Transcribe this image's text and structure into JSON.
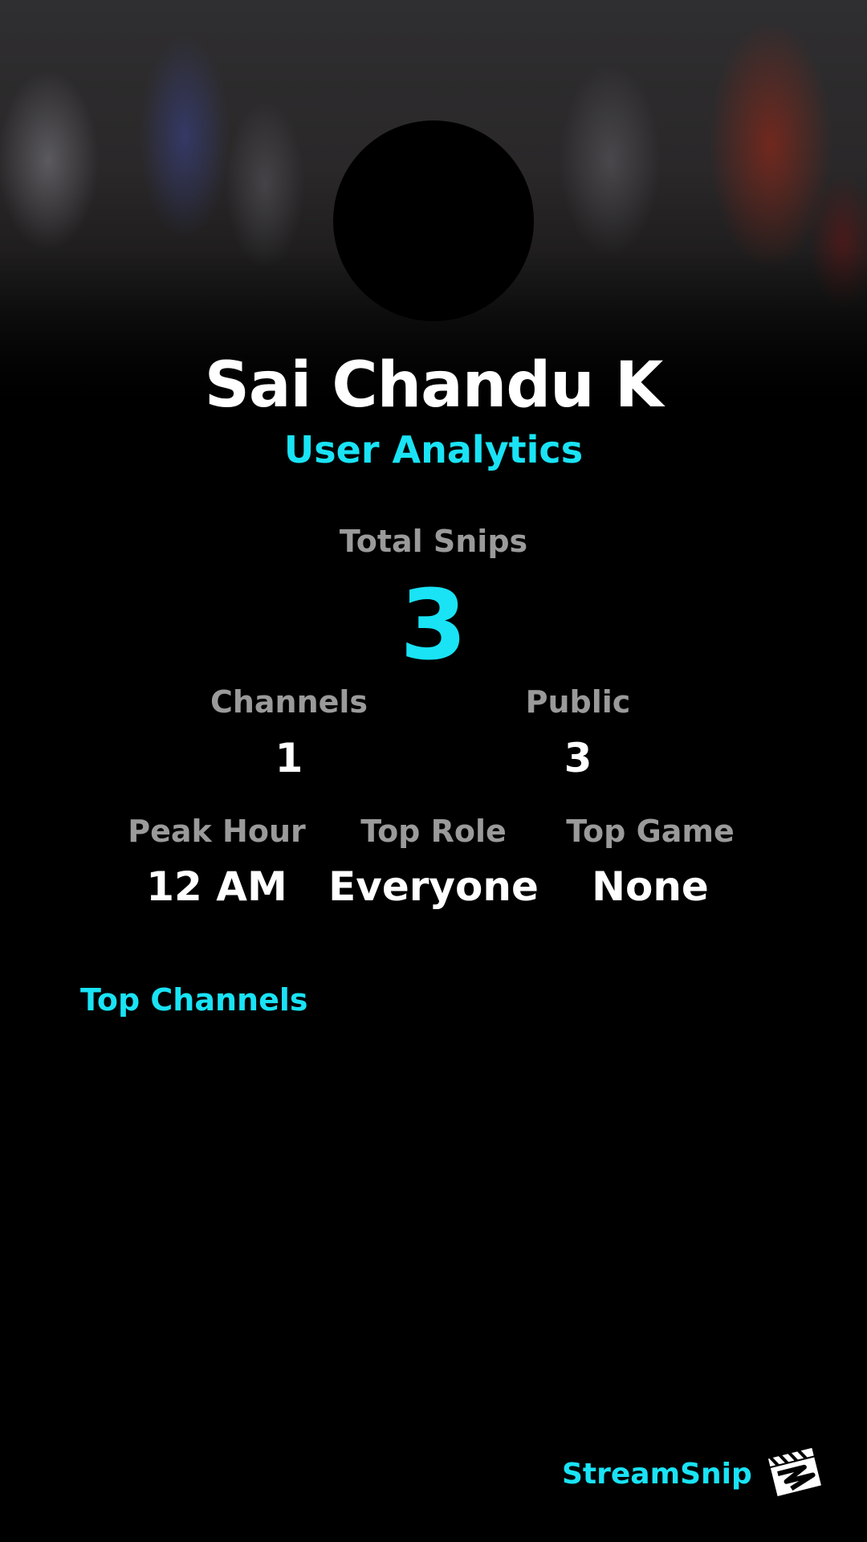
{
  "profile": {
    "name": "Sai Chandu K",
    "subtitle": "User Analytics"
  },
  "stats": {
    "total_snips_label": "Total Snips",
    "total_snips_value": "3",
    "channels_label": "Channels",
    "channels_value": "1",
    "public_label": "Public",
    "public_value": "3",
    "peak_hour_label": "Peak Hour",
    "peak_hour_value": "12 AM",
    "top_role_label": "Top Role",
    "top_role_value": "Everyone",
    "top_game_label": "Top Game",
    "top_game_value": "None"
  },
  "sections": {
    "top_channels_title": "Top Channels"
  },
  "footer": {
    "brand_name": "StreamSnip",
    "logo_icon": "clapperboard-logo-icon"
  },
  "colors": {
    "accent": "#19e3f5",
    "label_gray": "#9a9a9a",
    "background": "#000000"
  }
}
